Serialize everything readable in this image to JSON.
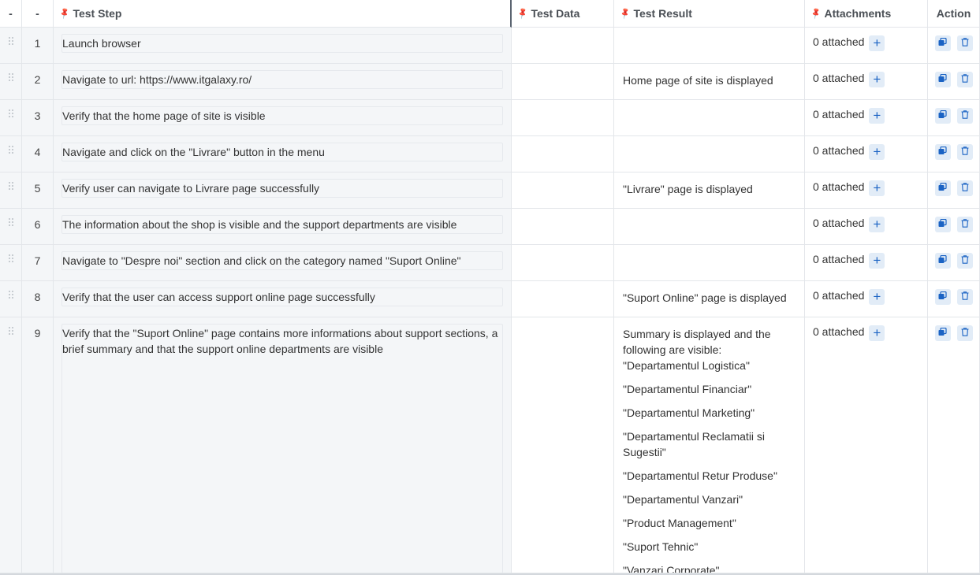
{
  "header": {
    "drag_col": "-",
    "num_col": "-",
    "test_step": "Test Step",
    "test_data": "Test Data",
    "test_result": "Test Result",
    "attachments": "Attachments",
    "action": "Action"
  },
  "colors": {
    "accent": "#1b63c4",
    "step_bg": "#f4f6f8",
    "button_bg": "#e2ecf7",
    "border": "#e3e6ea"
  },
  "icons": {
    "pin": "pin-icon",
    "drag": "drag-handle-icon",
    "add": "plus-icon",
    "clone": "clone-icon",
    "delete": "trash-icon"
  },
  "rows": [
    {
      "num": "1",
      "step": "Launch browser",
      "data": "",
      "result": [],
      "attachments": "0 attached"
    },
    {
      "num": "2",
      "step": "Navigate to url: https://www.itgalaxy.ro/",
      "data": "",
      "result": [
        "Home page of site is displayed"
      ],
      "attachments": "0 attached"
    },
    {
      "num": "3",
      "step": "Verify that the home page of site is visible",
      "data": "",
      "result": [],
      "attachments": "0 attached"
    },
    {
      "num": "4",
      "step": "Navigate and click on the \"Livrare\" button in the menu",
      "data": "",
      "result": [],
      "attachments": "0 attached"
    },
    {
      "num": "5",
      "step": "Verify user can navigate to Livrare page successfully",
      "data": "",
      "result": [
        "\"Livrare\" page is displayed"
      ],
      "attachments": "0 attached"
    },
    {
      "num": "6",
      "step": "The information about the shop is visible and the support departments are visible",
      "data": "",
      "result": [],
      "attachments": "0 attached"
    },
    {
      "num": "7",
      "step": "Navigate to \"Despre noi\" section and click on the category named \"Suport Online\"",
      "data": "",
      "result": [],
      "attachments": "0 attached"
    },
    {
      "num": "8",
      "step": "Verify that the user can access support online page successfully",
      "data": "",
      "result": [
        "\"Suport Online\" page is displayed"
      ],
      "attachments": "0 attached"
    },
    {
      "num": "9",
      "step": "Verify that the \"Suport Online\" page contains more informations about support sections, a brief summary and that the support online departments are visible",
      "data": "",
      "result": [
        "Summary is displayed and the following are visible: \"Departamentul Logistica\"",
        "\"Departamentul Financiar\"",
        "\"Departamentul Marketing\"",
        "\"Departamentul Reclamatii si Sugestii\"",
        "\"Departamentul Retur Produse\"",
        "\"Departamentul Vanzari\"",
        "\"Product Management\"",
        "\"Suport Tehnic\"",
        "\"Vanzari Corporate\""
      ],
      "attachments": "0 attached"
    }
  ]
}
